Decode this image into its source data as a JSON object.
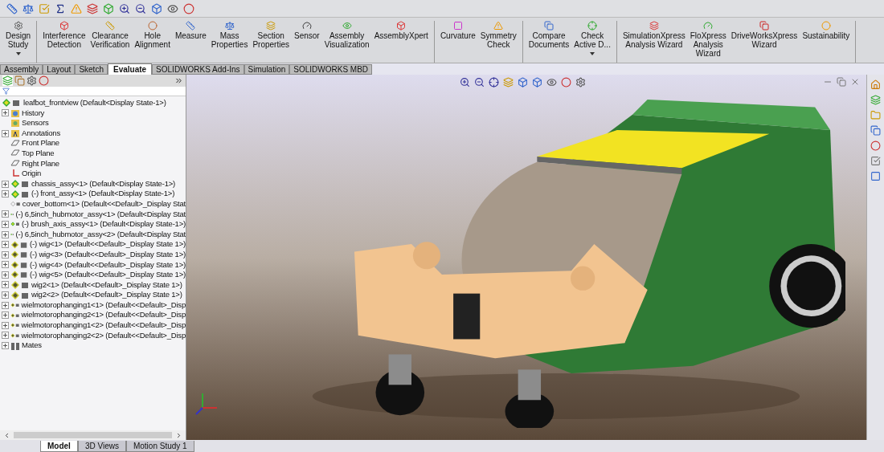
{
  "ribbon": {
    "groups": [
      {
        "buttons": [
          {
            "lines": [
              "Design",
              "Study"
            ],
            "dropdown": true
          }
        ]
      },
      {
        "buttons": [
          {
            "lines": [
              "Interference",
              "Detection"
            ],
            "dropdown": false
          },
          {
            "lines": [
              "Clearance",
              "Verification"
            ],
            "dropdown": false
          },
          {
            "lines": [
              "Hole",
              "Alignment"
            ],
            "dropdown": false
          },
          {
            "lines": [
              "Measure"
            ],
            "dropdown": false
          },
          {
            "lines": [
              "Mass",
              "Properties"
            ],
            "dropdown": false
          },
          {
            "lines": [
              "Section",
              "Properties"
            ],
            "dropdown": false
          },
          {
            "lines": [
              "Sensor"
            ],
            "dropdown": false
          },
          {
            "lines": [
              "Assembly",
              "Visualization"
            ],
            "dropdown": false
          },
          {
            "lines": [
              "AssemblyXpert"
            ],
            "dropdown": false
          }
        ]
      },
      {
        "buttons": [
          {
            "lines": [
              "Curvature"
            ],
            "dropdown": false
          },
          {
            "lines": [
              "Symmetry",
              "Check"
            ],
            "dropdown": false
          }
        ]
      },
      {
        "buttons": [
          {
            "lines": [
              "Compare",
              "Documents"
            ],
            "dropdown": false
          },
          {
            "lines": [
              "Check",
              "Active D..."
            ],
            "dropdown": true
          }
        ]
      },
      {
        "buttons": [
          {
            "lines": [
              "SimulationXpress",
              "Analysis Wizard"
            ],
            "dropdown": false
          },
          {
            "lines": [
              "FloXpress",
              "Analysis",
              "Wizard"
            ],
            "dropdown": false
          },
          {
            "lines": [
              "DriveWorksXpress",
              "Wizard"
            ],
            "dropdown": false
          },
          {
            "lines": [
              "Sustainability"
            ],
            "dropdown": false
          }
        ]
      }
    ]
  },
  "command_tabs": [
    {
      "label": "Assembly",
      "selected": false
    },
    {
      "label": "Layout",
      "selected": false
    },
    {
      "label": "Sketch",
      "selected": false
    },
    {
      "label": "Evaluate",
      "selected": true
    },
    {
      "label": "SOLIDWORKS Add-Ins",
      "selected": false
    },
    {
      "label": "Simulation",
      "selected": false
    },
    {
      "label": "SOLIDWORKS MBD",
      "selected": false
    }
  ],
  "feature_tree": {
    "root": {
      "text": "leafbot_frontview  (Default<Display State-1>)",
      "kind": "assembly"
    },
    "children": [
      {
        "text": "History",
        "kind": "history",
        "expandable": true
      },
      {
        "text": "Sensors",
        "kind": "sensor",
        "expandable": false
      },
      {
        "text": "Annotations",
        "kind": "annotation",
        "expandable": true
      },
      {
        "text": "Front Plane",
        "kind": "plane",
        "expandable": false
      },
      {
        "text": "Top Plane",
        "kind": "plane",
        "expandable": false
      },
      {
        "text": "Right Plane",
        "kind": "plane",
        "expandable": false
      },
      {
        "text": "Origin",
        "kind": "origin",
        "expandable": false
      },
      {
        "text": "chassis_assy<1> (Default<Display State-1>)",
        "kind": "assembly",
        "expandable": true
      },
      {
        "text": "(-) front_assy<1> (Default<Display State-1>)",
        "kind": "assembly",
        "expandable": true
      },
      {
        "text": "cover_bottom<1> (Default<<Default>_Display Stat",
        "kind": "part",
        "expandable": false
      },
      {
        "text": "(-) 6,5inch_hubmotor_assy<1> (Default<Display Stat",
        "kind": "assembly",
        "expandable": true
      },
      {
        "text": "(-) brush_axis_assy<1> (Default<Display State-1>)",
        "kind": "assembly",
        "expandable": true
      },
      {
        "text": "(-) 6,5inch_hubmotor_assy<2> (Default<Display Stat",
        "kind": "assembly",
        "expandable": true
      },
      {
        "text": "(-) wig<1> (Default<<Default>_Display State 1>)",
        "kind": "subassembly",
        "expandable": true
      },
      {
        "text": "(-) wig<3> (Default<<Default>_Display State 1>)",
        "kind": "subassembly",
        "expandable": true
      },
      {
        "text": "(-) wig<4> (Default<<Default>_Display State 1>)",
        "kind": "subassembly",
        "expandable": true
      },
      {
        "text": "(-) wig<5> (Default<<Default>_Display State 1>)",
        "kind": "subassembly",
        "expandable": true
      },
      {
        "text": "wig2<1> (Default<<Default>_Display State 1>)",
        "kind": "subassembly",
        "expandable": true
      },
      {
        "text": "wig2<2> (Default<<Default>_Display State 1>)",
        "kind": "subassembly",
        "expandable": true
      },
      {
        "text": "wielmotorophanging1<1> (Default<<Default>_Disp",
        "kind": "subassembly",
        "expandable": true
      },
      {
        "text": "wielmotorophanging2<1> (Default<<Default>_Disp",
        "kind": "subassembly",
        "expandable": true
      },
      {
        "text": "wielmotorophanging1<2> (Default<<Default>_Disp",
        "kind": "subassembly",
        "expandable": true
      },
      {
        "text": "wielmotorophanging2<2> (Default<<Default>_Disp",
        "kind": "subassembly",
        "expandable": true
      },
      {
        "text": "Mates",
        "kind": "mates",
        "expandable": true
      }
    ]
  },
  "bottom_tabs": [
    {
      "label": "Model",
      "selected": true
    },
    {
      "label": "3D Views",
      "selected": false
    },
    {
      "label": "Motion Study 1",
      "selected": false
    }
  ]
}
